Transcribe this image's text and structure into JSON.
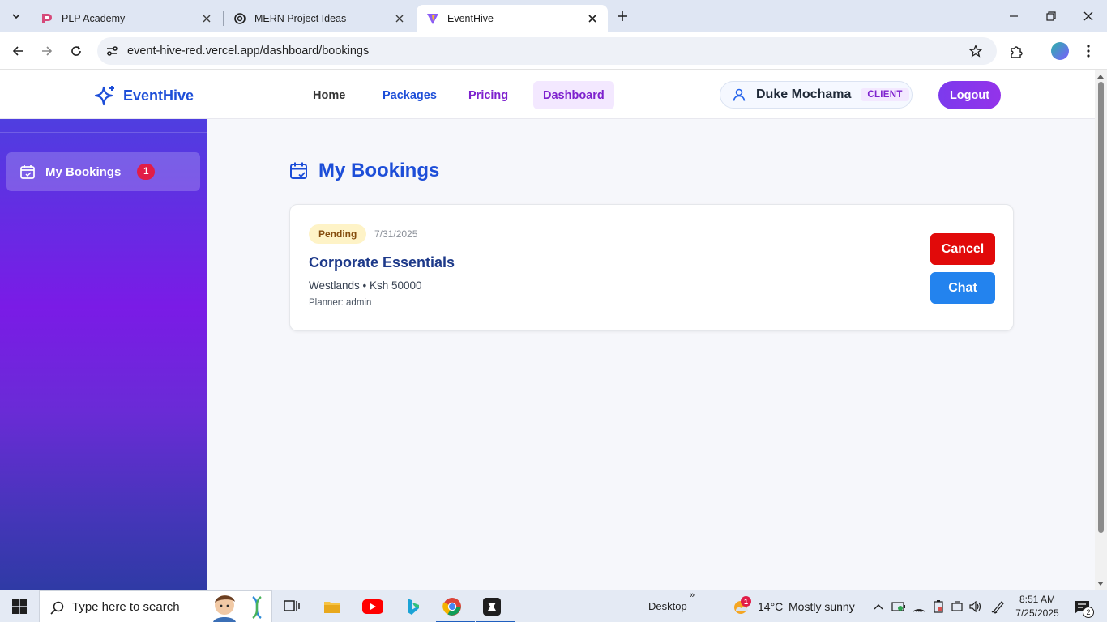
{
  "browser": {
    "tabs": [
      {
        "title": "PLP Academy",
        "icon": "plp-academy-favicon"
      },
      {
        "title": "MERN Project Ideas",
        "icon": "openai-favicon"
      },
      {
        "title": "EventHive",
        "icon": "vite-favicon"
      }
    ],
    "active_tab": 2,
    "url": "event-hive-red.vercel.app/dashboard/bookings"
  },
  "navbar": {
    "brand": "EventHive",
    "links": [
      {
        "label": "Home",
        "color": "#333333"
      },
      {
        "label": "Packages",
        "color": "#1d4ed8"
      },
      {
        "label": "Pricing",
        "color": "#7e22ce"
      },
      {
        "label": "Dashboard",
        "color": "#7e22ce",
        "active": true
      }
    ],
    "user": {
      "name": "Duke Mochama",
      "role": "CLIENT"
    },
    "logout_label": "Logout"
  },
  "sidebar": {
    "items": [
      {
        "label": "My Bookings",
        "badge": "1",
        "icon": "calendar-icon",
        "active": true
      }
    ]
  },
  "main": {
    "heading": "My Bookings",
    "bookings": [
      {
        "status": "Pending",
        "date": "7/31/2025",
        "package": "Corporate Essentials",
        "location_price": "Westlands • Ksh 50000",
        "planner": "Planner: admin",
        "cancel_label": "Cancel",
        "chat_label": "Chat"
      }
    ]
  },
  "taskbar": {
    "search_placeholder": "Type here to search",
    "desktop_label": "Desktop",
    "weather": {
      "temp": "14°C",
      "condition": "Mostly sunny",
      "alert_count": "1"
    },
    "time": "8:51 AM",
    "date": "7/25/2025",
    "notification_count": "2"
  },
  "colors": {
    "brand_blue": "#1d4ed8",
    "accent_purple": "#7c3aed",
    "pending_bg": "#fef3c7",
    "cancel_red": "#e10a0a",
    "chat_blue": "#2383ee"
  }
}
